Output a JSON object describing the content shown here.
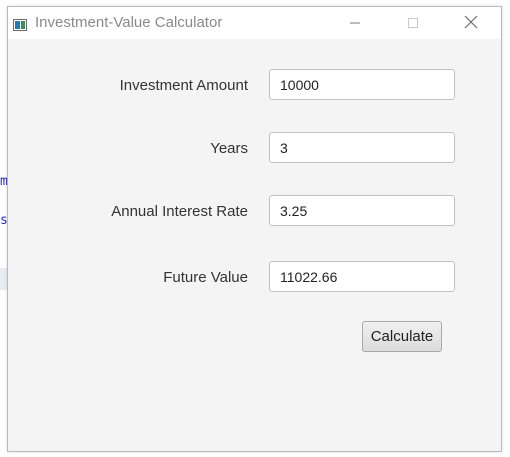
{
  "background": {
    "code_fragments": [
      "m",
      "s"
    ]
  },
  "window": {
    "title": "Investment-Value Calculator",
    "accent_color": "#1f7bb6"
  },
  "form": {
    "fields": [
      {
        "label": "Investment Amount",
        "value": "10000"
      },
      {
        "label": "Years",
        "value": "3"
      },
      {
        "label": "Annual Interest Rate",
        "value": "3.25"
      },
      {
        "label": "Future Value",
        "value": "11022.66"
      }
    ],
    "calculate_label": "Calculate"
  },
  "icons": {
    "app": "app-window-icon",
    "minimize": "minimize-icon",
    "maximize": "maximize-icon",
    "close": "close-icon"
  }
}
